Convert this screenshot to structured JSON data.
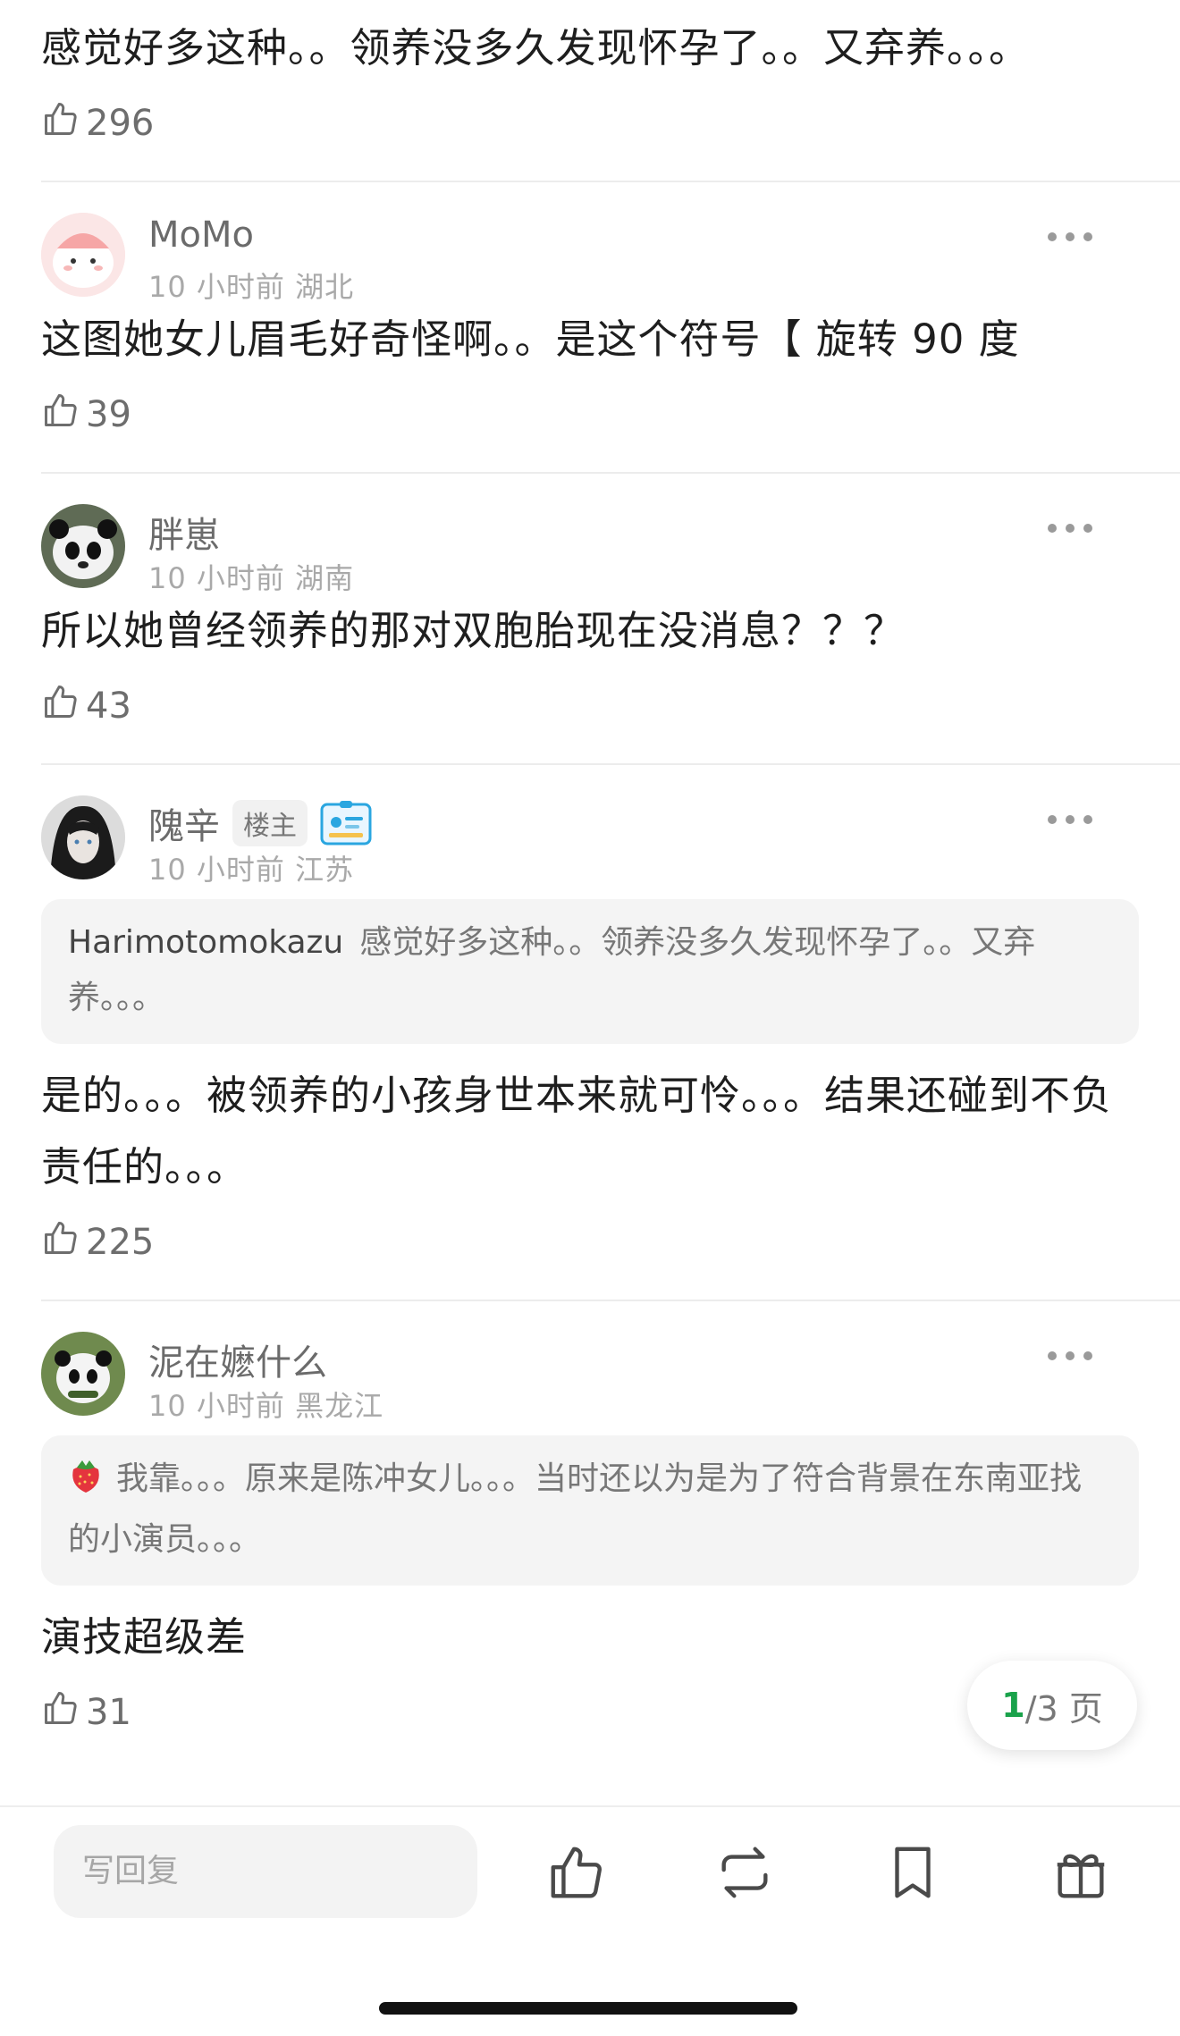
{
  "comments": [
    {
      "text": "感觉好多这种。。领养没多久发现怀孕了。。又弃养。。。",
      "likes": "296"
    },
    {
      "user": "MoMo",
      "time": "10 小时前",
      "location": "湖北",
      "text": "这图她女儿眉毛好奇怪啊。。是这个符号【 旋转 90 度",
      "likes": "39"
    },
    {
      "user": "胖崽",
      "time": "10 小时前",
      "location": "湖南",
      "text": "所以她曾经领养的那对双胞胎现在没消息？？？",
      "likes": "43"
    },
    {
      "user": "隗辛",
      "badge": "楼主",
      "time": "10 小时前",
      "location": "江苏",
      "quote_user": "Harimotomokazu",
      "quote_text": "感觉好多这种。。领养没多久发现怀孕了。。又弃养。。。",
      "text": "是的。。。被领养的小孩身世本来就可怜。。。结果还碰到不负责任的。。。",
      "likes": "225"
    },
    {
      "user": "泥在嬷什么",
      "time": "10 小时前",
      "location": "黑龙江",
      "quote_text": "我靠。。。原来是陈冲女儿。。。当时还以为是为了符合背景在东南亚找的小演员。。。",
      "text": "演技超级差",
      "likes": "31"
    }
  ],
  "pager": {
    "current": "1",
    "total": "/3 页"
  },
  "bottom_bar": {
    "reply_placeholder": "写回复"
  },
  "icons": [
    "like-icon",
    "more-icon",
    "strawberry-icon",
    "thumb-up-icon",
    "repost-icon",
    "bookmark-icon",
    "gift-icon"
  ],
  "colors": {
    "accent": "#1aa24b",
    "muted": "#a9a9a9"
  }
}
